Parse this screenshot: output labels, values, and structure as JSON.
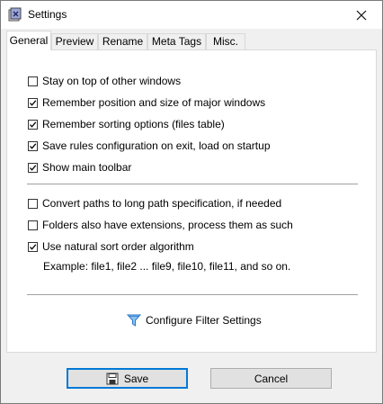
{
  "window": {
    "title": "Settings"
  },
  "tabs": [
    {
      "label": "General",
      "active": true
    },
    {
      "label": "Preview",
      "active": false
    },
    {
      "label": "Rename",
      "active": false
    },
    {
      "label": "Meta Tags",
      "active": false
    },
    {
      "label": "Misc.",
      "active": false
    }
  ],
  "general": {
    "options_group1": [
      {
        "label": "Stay on top of other windows",
        "checked": false
      },
      {
        "label": "Remember position and size of major windows",
        "checked": true
      },
      {
        "label": "Remember sorting options (files table)",
        "checked": true
      },
      {
        "label": "Save rules configuration on exit, load on startup",
        "checked": true
      },
      {
        "label": "Show main toolbar",
        "checked": true
      }
    ],
    "options_group2": [
      {
        "label": "Convert paths to long path specification, if needed",
        "checked": false
      },
      {
        "label": "Folders also have extensions, process them as such",
        "checked": false
      },
      {
        "label": "Use natural sort order algorithm",
        "checked": true
      }
    ],
    "example_text": "Example: file1, file2 ... file9, file10, file11, and so on.",
    "filter_link_label": "Configure Filter Settings"
  },
  "buttons": {
    "save": "Save",
    "cancel": "Cancel"
  },
  "colors": {
    "accent": "#0078d7",
    "filter_icon": "#3a8fd8"
  }
}
